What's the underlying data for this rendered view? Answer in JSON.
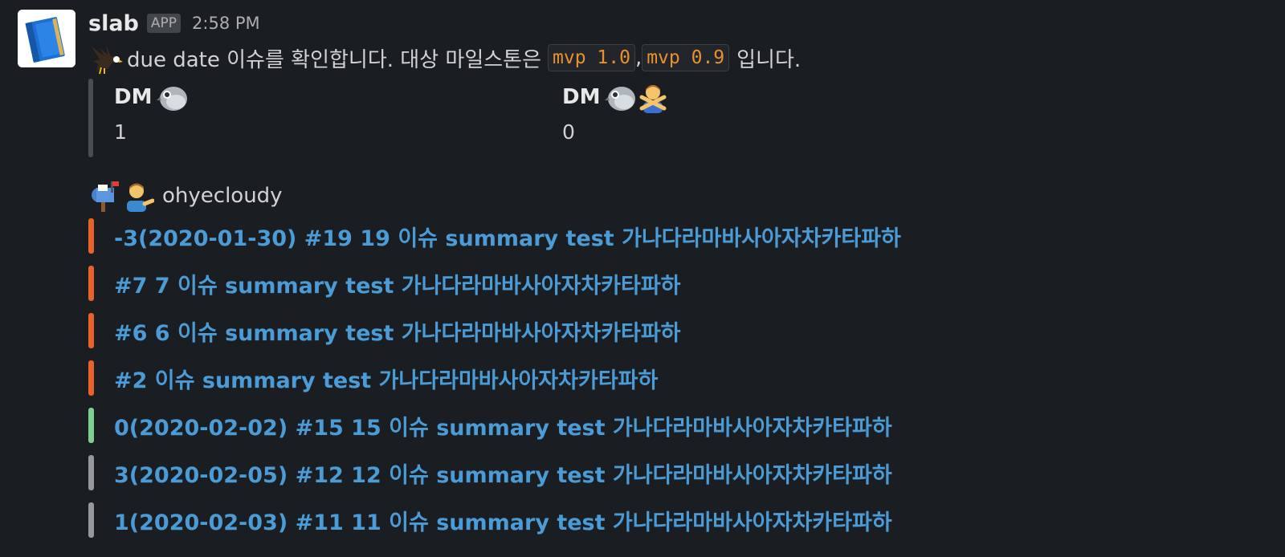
{
  "message": {
    "sender": "slab",
    "badge": "APP",
    "timestamp": "2:58 PM",
    "text_before": "due date 이슈를 확인합니다. 대상 마일스톤은",
    "milestones": [
      "mvp 1.0",
      "mvp 0.9"
    ],
    "separator": ",",
    "text_after": "입니다.",
    "icon": "eagle-icon"
  },
  "stats": {
    "bar_color": "#4a4d52",
    "fields": [
      {
        "title": "DM",
        "icons": [
          "pigeon-icon"
        ],
        "value": "1"
      },
      {
        "title": "DM",
        "icons": [
          "pigeon-icon",
          "person-no-gesture-icon"
        ],
        "value": "0"
      }
    ]
  },
  "owner": {
    "icons": [
      "mailbox-icon",
      "person-tipping-hand-icon"
    ],
    "name": "ohyecloudy"
  },
  "status_colors": {
    "overdue": "#e8622c",
    "today": "#7fce8f",
    "upcoming": "#96989b"
  },
  "link_color": "#4a9bd6",
  "issues": [
    {
      "text": "-3(2020-01-30) #19 19 이슈 summary test 가나다라마바사아자차카타파하",
      "status": "overdue",
      "color": "#e8622c"
    },
    {
      "text": "#7 7 이슈 summary test 가나다라마바사아자차카타파하",
      "status": "overdue",
      "color": "#e8622c"
    },
    {
      "text": "#6 6 이슈 summary test 가나다라마바사아자차카타파하",
      "status": "overdue",
      "color": "#e8622c"
    },
    {
      "text": "#2 이슈 summary test 가나다라마바사아자차카타파하",
      "status": "overdue",
      "color": "#e8622c"
    },
    {
      "text": "0(2020-02-02) #15 15 이슈 summary test 가나다라마바사아자차카타파하",
      "status": "today",
      "color": "#7fce8f"
    },
    {
      "text": "3(2020-02-05) #12 12 이슈 summary test 가나다라마바사아자차카타파하",
      "status": "upcoming",
      "color": "#96989b"
    },
    {
      "text": "1(2020-02-03) #11 11 이슈 summary test 가나다라마바사아자차카타파하",
      "status": "upcoming",
      "color": "#96989b"
    }
  ]
}
